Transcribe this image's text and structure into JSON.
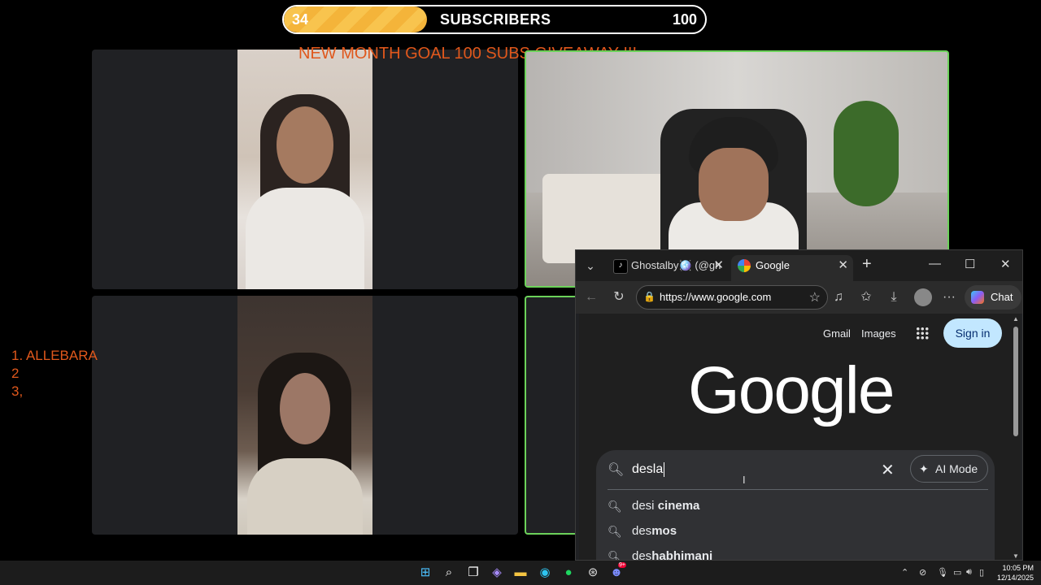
{
  "goal": {
    "current": "34",
    "title": "SUBSCRIBERS",
    "target": "100",
    "progress": 0.34,
    "message": "NEW MONTH GOAL 100 SUBS GIVEAWAY !!!",
    "fill_color": "#f4b43a"
  },
  "winners": [
    "1.  ALLEBARA",
    "2",
    "3,"
  ],
  "browser": {
    "tabs": [
      {
        "label": "Ghostalby🪩 (@gh",
        "icon": "tiktok-icon"
      },
      {
        "label": "Google",
        "icon": "google-icon"
      }
    ],
    "url": "https://www.google.com",
    "chat_label": "Chat"
  },
  "google": {
    "gmail": "Gmail",
    "images": "Images",
    "signin": "Sign in",
    "logo": "Google",
    "query": "desla",
    "ai_mode": "AI Mode",
    "suggestions": [
      {
        "prefix": "des",
        "rest": "i cinema",
        "prefix_plain": "desi",
        "bold": " cinema"
      },
      {
        "prefix_plain": "des",
        "bold": "mos"
      },
      {
        "prefix_plain": "des",
        "bold": "habhimani"
      }
    ]
  },
  "taskbar": {
    "time": "10:05 PM",
    "date": "12/14/2025",
    "discord_badge": "9+"
  },
  "colors": {
    "highlight_border": "#6cd25a",
    "overlay_text": "#e0581c"
  }
}
